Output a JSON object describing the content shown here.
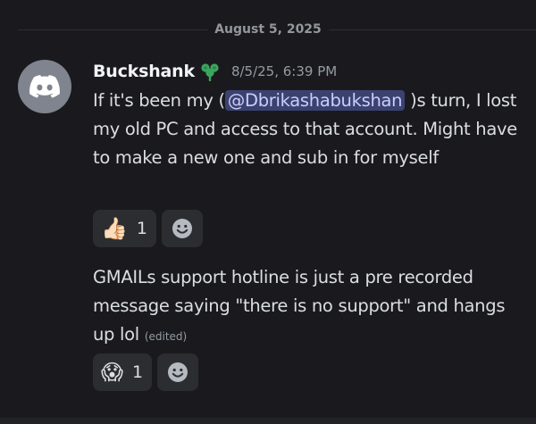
{
  "divider": {
    "date": "August 5, 2025"
  },
  "message": {
    "author": "Buckshank",
    "timestamp": "8/5/25, 6:39 PM",
    "role_icon": "clover-icon",
    "first": {
      "text_before": "If it's been my (",
      "mention": "@Dbrikashabukshan",
      "text_after": " )s turn, I lost my old PC and access to that account. Might have to make a new one and sub in for myself",
      "reaction": {
        "emoji": "👍🏻",
        "count": "1"
      }
    },
    "second": {
      "text": "GMAILs support hotline is just a pre recorded message saying \"there is no support\" and hangs up lol",
      "edited": "(edited)",
      "reaction": {
        "emoji": "😱",
        "count": "1"
      }
    }
  },
  "colors": {
    "background": "#1a1a1e",
    "mention_bg": "#3c4270",
    "mention_fg": "#c9cdfb",
    "avatar_bg": "#80848e",
    "role_icon": "#3ba55d"
  }
}
